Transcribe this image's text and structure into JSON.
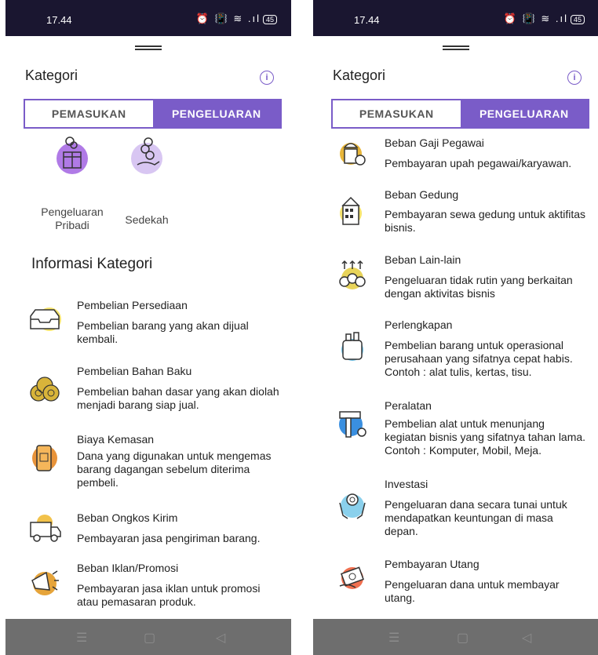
{
  "left": {
    "status": {
      "time": "17.44",
      "icons": "⏰ 📳 ≋ .ıl",
      "battery": "45"
    },
    "header": {
      "title": "Kategori"
    },
    "tabs": [
      {
        "label": "PEMASUKAN"
      },
      {
        "label": "PENGELUARAN"
      }
    ],
    "categories": [
      {
        "label": "Pengeluaran Pribadi",
        "icon": "gift-box-icon",
        "color": "#b07ae6"
      },
      {
        "label": "Sedekah",
        "icon": "hand-coins-icon",
        "color": "#d8c6f2"
      }
    ],
    "section_title": "Informasi Kategori",
    "items": [
      {
        "title": "Pembelian Persediaan",
        "desc": "Pembelian barang yang akan dijual kembali.",
        "icon": "tray-icon",
        "color": "#f5e36b"
      },
      {
        "title": "Pembelian Bahan Baku",
        "desc": "Pembelian bahan dasar yang akan diolah menjadi barang siap jual.",
        "icon": "logs-icon",
        "color": "#d8b43a"
      },
      {
        "title": "Biaya Kemasan",
        "desc": "Dana yang digunakan untuk mengemas barang dagangan sebelum diterima pembeli.",
        "icon": "package-jar-icon",
        "color": "#e8933a"
      },
      {
        "title": "Beban Ongkos Kirim",
        "desc": "Pembayaran jasa pengiriman barang.",
        "icon": "delivery-truck-icon",
        "color": "#f2c24a"
      },
      {
        "title": "Beban Iklan/Promosi",
        "desc": "Pembayaran jasa iklan untuk promosi atau pemasaran produk.",
        "icon": "megaphone-icon",
        "color": "#e6a43a"
      }
    ]
  },
  "right": {
    "status": {
      "time": "17.44",
      "icons": "⏰ 📳 ≋ .ıl",
      "battery": "45"
    },
    "header": {
      "title": "Kategori"
    },
    "tabs": [
      {
        "label": "PEMASUKAN"
      },
      {
        "label": "PENGELUARAN"
      }
    ],
    "items": [
      {
        "title": "Beban Gaji Pegawai",
        "desc": "Pembayaran upah pegawai/karyawan.",
        "icon": "worker-icon",
        "color": "#e8b63a"
      },
      {
        "title": "Beban Gedung",
        "desc": "Pembayaran sewa gedung untuk aktifitas bisnis.",
        "icon": "building-icon",
        "color": "#f5e36b"
      },
      {
        "title": "Beban Lain-lain",
        "desc": "Pengeluaran tidak rutin yang berkaitan dengan aktivitas bisnis",
        "icon": "coins-arrows-icon",
        "color": "#e8d45a"
      },
      {
        "title": "Perlengkapan",
        "desc": "Pembelian barang untuk operasional perusahaan yang sifatnya cepat habis. Contoh : alat tulis, kertas, tisu.",
        "icon": "supplies-icon",
        "color": "#6fc3e8"
      },
      {
        "title": "Peralatan",
        "desc": "Pembelian alat untuk menunjang kegiatan bisnis yang sifatnya tahan lama. Contoh : Komputer, Mobil, Meja.",
        "icon": "tools-icon",
        "color": "#3a8fe0"
      },
      {
        "title": "Investasi",
        "desc": "Pengeluaran dana secara tunai untuk mendapatkan keuntungan di masa depan.",
        "icon": "invest-hands-icon",
        "color": "#8ad0ec"
      },
      {
        "title": "Pembayaran Utang",
        "desc": "Pengeluaran dana untuk membayar utang.",
        "icon": "cash-hand-icon",
        "color": "#f07050"
      }
    ]
  },
  "nav": {
    "menu": "☰",
    "home": "▢",
    "back": "◁"
  },
  "colors": {
    "accent": "#7a5cc8",
    "status_bg": "#1a1630",
    "nav_bg": "#6e6e6e"
  }
}
